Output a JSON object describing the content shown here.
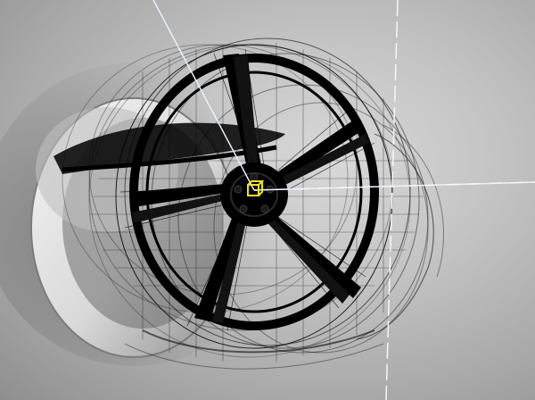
{
  "scene": {
    "object": "wheel-rim-wireframe",
    "render_mode": "wireframe-over-shaded",
    "spoke_count": 5,
    "colors": {
      "background_center": "#d8d8d8",
      "background_edge": "#8f8f8f",
      "wire": "#0b0b0b",
      "ghost_rim": "#f2f2f2",
      "axis_line": "#e8f1ff",
      "pivot_gizmo": "#f2e21a"
    }
  },
  "icons": {
    "pivot": "pivot-cube-icon"
  }
}
